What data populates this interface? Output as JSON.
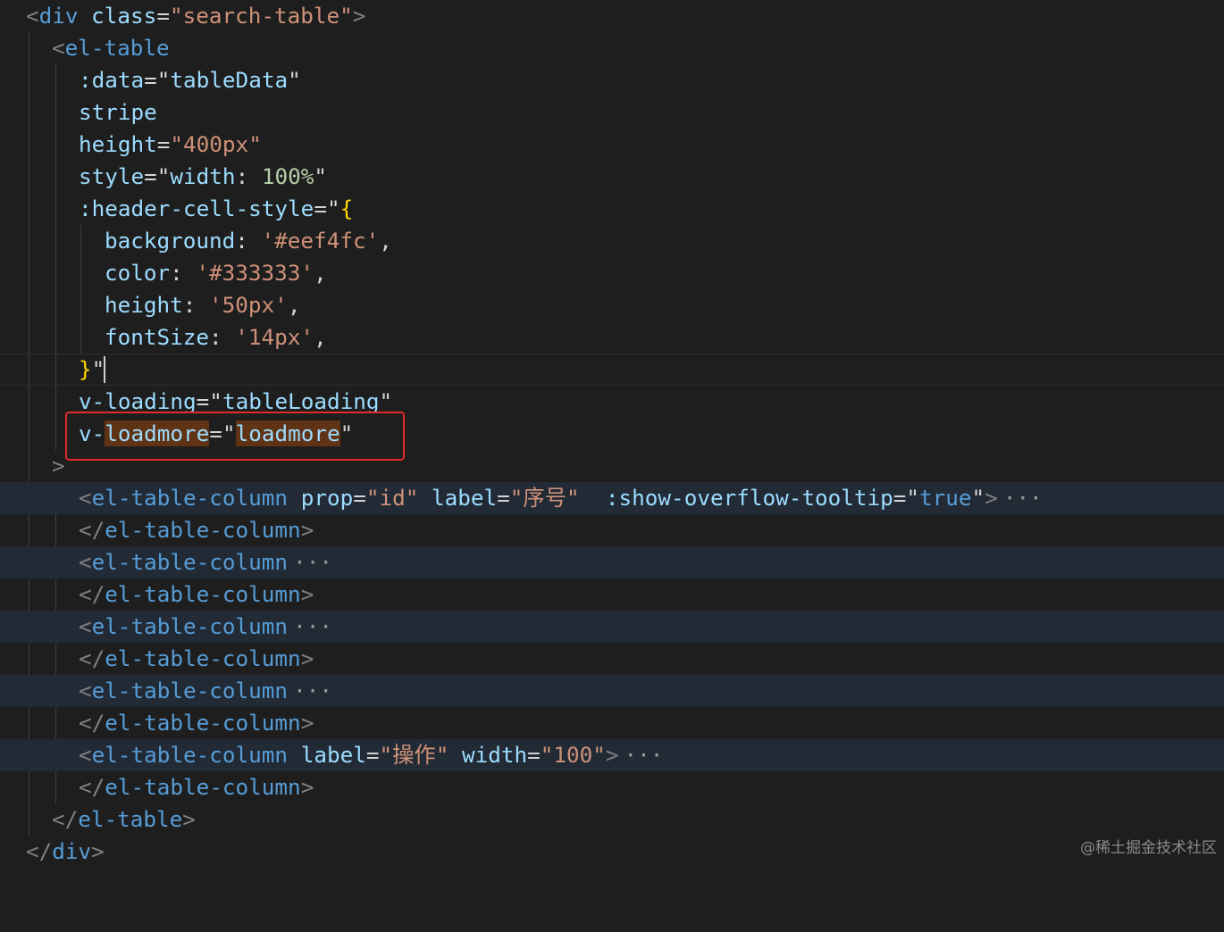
{
  "editor": {
    "lines": {
      "l1": {
        "open": "<",
        "tag": "div",
        "attr": "class",
        "eq": "=",
        "val": "\"search-table\"",
        "close": ">"
      },
      "l2": {
        "open": "<",
        "tag": "el-table"
      },
      "l3": {
        "attr": ":data",
        "eq": "=",
        "q1": "\"",
        "val": "tableData",
        "q2": "\""
      },
      "l4": {
        "attr": "stripe"
      },
      "l5": {
        "attr": "height",
        "eq": "=",
        "val": "\"400px\""
      },
      "l6": {
        "attr": "style",
        "eq": "=",
        "q1": "\"",
        "prop": "width",
        "colon": ": ",
        "num": "100%",
        "q2": "\""
      },
      "l7": {
        "attr": ":header-cell-style",
        "eq": "=",
        "q1": "\"",
        "brace": "{"
      },
      "l8": {
        "key": "background",
        "colon": ": ",
        "val": "'#eef4fc'",
        "comma": ","
      },
      "l9": {
        "key": "color",
        "colon": ": ",
        "val": "'#333333'",
        "comma": ","
      },
      "l10": {
        "key": "height",
        "colon": ": ",
        "val": "'50px'",
        "comma": ","
      },
      "l11": {
        "key": "fontSize",
        "colon": ": ",
        "val": "'14px'",
        "comma": ","
      },
      "l12": {
        "brace": "}",
        "q": "\""
      },
      "l13": {
        "attr": "v-loading",
        "eq": "=",
        "q1": "\"",
        "val": "tableLoading",
        "q2": "\""
      },
      "l14": {
        "attr_prefix": "v-",
        "attr_match": "loadmore",
        "eq": "=",
        "q1": "\"",
        "val": "loadmore",
        "q2": "\""
      },
      "l15": {
        "close": ">"
      },
      "l16": {
        "open": "<",
        "tag": "el-table-column",
        "a1": "prop",
        "eq1": "=",
        "v1": "\"id\"",
        "a2": "label",
        "eq2": "=",
        "v2": "\"序号\"",
        "a3": ":show-overflow-tooltip",
        "eq3": "=",
        "q1": "\"",
        "v3": "true",
        "q2": "\"",
        "close": ">",
        "fold": "···"
      },
      "l17": {
        "open": "</",
        "tag": "el-table-column",
        "close": ">"
      },
      "l18": {
        "open": "<",
        "tag": "el-table-column",
        "fold": "···"
      },
      "l19": {
        "open": "</",
        "tag": "el-table-column",
        "close": ">"
      },
      "l20": {
        "open": "<",
        "tag": "el-table-column",
        "fold": "···"
      },
      "l21": {
        "open": "</",
        "tag": "el-table-column",
        "close": ">"
      },
      "l22": {
        "open": "<",
        "tag": "el-table-column",
        "fold": "···"
      },
      "l23": {
        "open": "</",
        "tag": "el-table-column",
        "close": ">"
      },
      "l24": {
        "open": "<",
        "tag": "el-table-column",
        "a1": "label",
        "eq1": "=",
        "v1": "\"操作\"",
        "a2": "width",
        "eq2": "=",
        "v2": "\"100\"",
        "close": ">",
        "fold": "···"
      },
      "l25": {
        "open": "</",
        "tag": "el-table-column",
        "close": ">"
      },
      "l26": {
        "open": "</",
        "tag": "el-table",
        "close": ">"
      },
      "l27": {
        "open": "</",
        "tag": "div",
        "close": ">"
      }
    }
  },
  "watermark": "@稀土掘金技术社区",
  "colors": {
    "background": "#1e1e1e",
    "tag": "#569cd6",
    "attribute": "#9cdcfe",
    "string": "#ce9178",
    "number": "#b5cea8",
    "brace": "#ffd700",
    "highlight_box": "#e02b2b",
    "word_match": "#613315"
  }
}
